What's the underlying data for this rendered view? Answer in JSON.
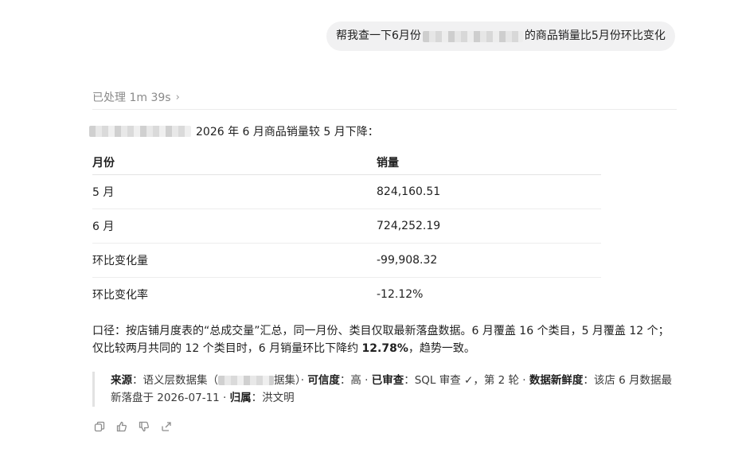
{
  "user_message": {
    "prefix": "帮我查一下6月份",
    "suffix": "的商品销量比5月份环比变化"
  },
  "processed": {
    "label": "已处理 1m 39s",
    "chevron": "›"
  },
  "intro": {
    "text": "2026 年 6 月商品销量较 5 月下降："
  },
  "table": {
    "headers": [
      "月份",
      "销量"
    ],
    "rows": [
      {
        "month": "5 月",
        "value": "824,160.51"
      },
      {
        "month": "6 月",
        "value": "724,252.19"
      },
      {
        "month": "环比变化量",
        "value": "-99,908.32"
      },
      {
        "month": "环比变化率",
        "value": "-12.12%"
      }
    ]
  },
  "note": {
    "prefix": "口径：按店铺月度表的“总成交量”汇总，同一月份、类目仅取最新落盘数据。6 月覆盖 16 个类目，5 月覆盖 12 个；仅比较两月共同的 12 个类目时，6 月销量环比下降约 ",
    "highlight": "12.78%",
    "suffix": "，趋势一致。"
  },
  "source": {
    "source_label": "来源",
    "source_prefix": "：语义层数据集（",
    "source_suffix": "据集）· ",
    "confidence_label": "可信度",
    "confidence_value": "：高 · ",
    "reviewed_label": "已审查",
    "reviewed_value": "：SQL 审查 ✓，第 2 轮 · ",
    "freshness_label": "数据新鲜度",
    "freshness_value": "：该店 6 月数据最新落盘于 2026-07-11 · ",
    "owner_label": "归属",
    "owner_value": "：洪文明"
  },
  "actions": [
    "copy-icon",
    "thumbs-up-icon",
    "thumbs-down-icon",
    "share-icon"
  ],
  "colors": {
    "bubble_bg": "#f1f1f2",
    "muted": "#8a8a8a",
    "divider": "#ececec"
  }
}
